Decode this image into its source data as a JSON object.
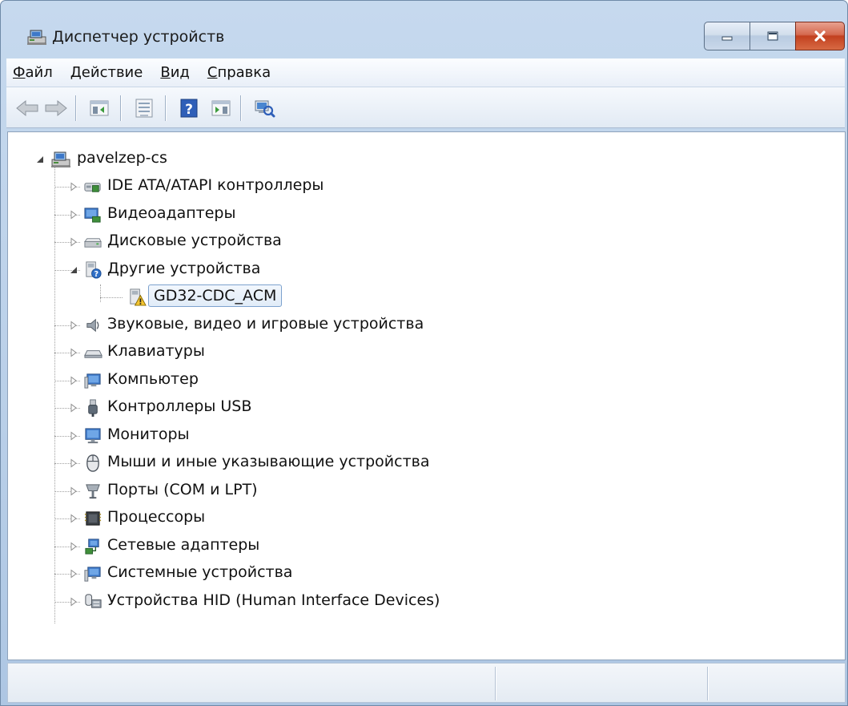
{
  "window": {
    "title": "Диспетчер устройств"
  },
  "menu": {
    "items": [
      {
        "label": "Файл",
        "accel": "Ф",
        "rest": "айл"
      },
      {
        "label": "Действие",
        "accel": "Д",
        "rest": "ействие"
      },
      {
        "label": "Вид",
        "accel": "В",
        "rest": "ид"
      },
      {
        "label": "Справка",
        "accel": "С",
        "rest": "правка"
      }
    ]
  },
  "toolbar": {
    "buttons": [
      {
        "icon": "back-arrow-icon"
      },
      {
        "icon": "forward-arrow-icon"
      },
      {
        "icon": "show-hide-console-tree-icon"
      },
      {
        "icon": "properties-icon"
      },
      {
        "icon": "help-icon"
      },
      {
        "icon": "action-pane-icon"
      },
      {
        "icon": "scan-hardware-icon"
      }
    ]
  },
  "tree": {
    "root": {
      "label": "pavelzep-cs",
      "icon": "computer-icon",
      "expanded": true
    },
    "items": [
      {
        "label": "IDE ATA/ATAPI контроллеры",
        "icon": "ide-controller-icon",
        "expanded": false
      },
      {
        "label": "Видеоадаптеры",
        "icon": "display-adapter-icon",
        "expanded": false
      },
      {
        "label": "Дисковые устройства",
        "icon": "disk-drive-icon",
        "expanded": false
      },
      {
        "label": "Другие устройства",
        "icon": "unknown-device-icon",
        "expanded": true,
        "children": [
          {
            "label": "GD32-CDC_ACM",
            "icon": "warning-device-icon",
            "selected": true
          }
        ]
      },
      {
        "label": "Звуковые, видео и игровые устройства",
        "icon": "speaker-icon",
        "expanded": false
      },
      {
        "label": "Клавиатуры",
        "icon": "keyboard-icon",
        "expanded": false
      },
      {
        "label": "Компьютер",
        "icon": "computer-monitor-icon",
        "expanded": false
      },
      {
        "label": "Контроллеры USB",
        "icon": "usb-plug-icon",
        "expanded": false
      },
      {
        "label": "Мониторы",
        "icon": "monitor-icon",
        "expanded": false
      },
      {
        "label": "Мыши и иные указывающие устройства",
        "icon": "mouse-icon",
        "expanded": false
      },
      {
        "label": "Порты (COM и LPT)",
        "icon": "port-icon",
        "expanded": false
      },
      {
        "label": "Процессоры",
        "icon": "processor-icon",
        "expanded": false
      },
      {
        "label": "Сетевые адаптеры",
        "icon": "network-adapter-icon",
        "expanded": false
      },
      {
        "label": "Системные устройства",
        "icon": "system-device-icon",
        "expanded": false
      },
      {
        "label": "Устройства HID (Human Interface Devices)",
        "icon": "hid-device-icon",
        "expanded": false
      }
    ]
  },
  "colors": {
    "selection_border": "#7da2ce",
    "close_button": "#c2401f",
    "frame": "#b9cfe8"
  }
}
